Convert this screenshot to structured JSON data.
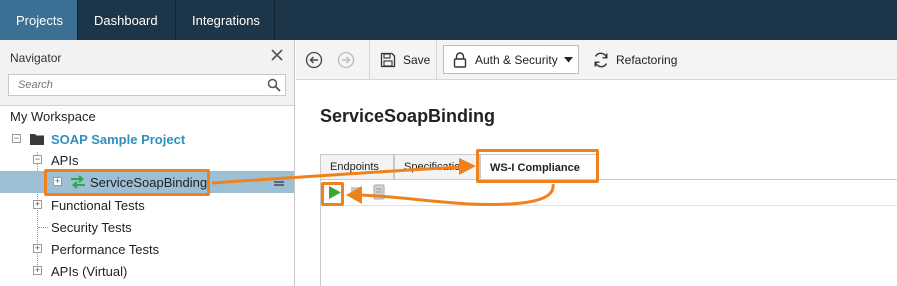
{
  "topnav": {
    "tabs": [
      {
        "label": "Projects",
        "active": true
      },
      {
        "label": "Dashboard",
        "active": false
      },
      {
        "label": "Integrations",
        "active": false
      }
    ]
  },
  "navigator": {
    "title": "Navigator",
    "search_placeholder": "Search",
    "workspace_label": "My Workspace",
    "project": "SOAP Sample Project",
    "apis": "APIs",
    "binding": "ServiceSoapBinding",
    "functional_tests": "Functional Tests",
    "security_tests": "Security Tests",
    "performance_tests": "Performance Tests",
    "apis_virtual": "APIs (Virtual)"
  },
  "toolbar": {
    "save_label": "Save",
    "auth_label": "Auth & Security",
    "refactoring_label": "Refactoring"
  },
  "editor": {
    "title": "ServiceSoapBinding",
    "tabs": [
      {
        "label": "Endpoints",
        "active": false
      },
      {
        "label": "Specification",
        "active": false
      },
      {
        "label": "WS-I Compliance",
        "active": true
      }
    ]
  },
  "colors": {
    "topbar": "#1d3549",
    "active_tab": "#3b6f94",
    "selected_row": "#9cbfd6",
    "project_text": "#2f8fbf",
    "highlight": "#f0821e",
    "run_green": "#3aa835"
  }
}
